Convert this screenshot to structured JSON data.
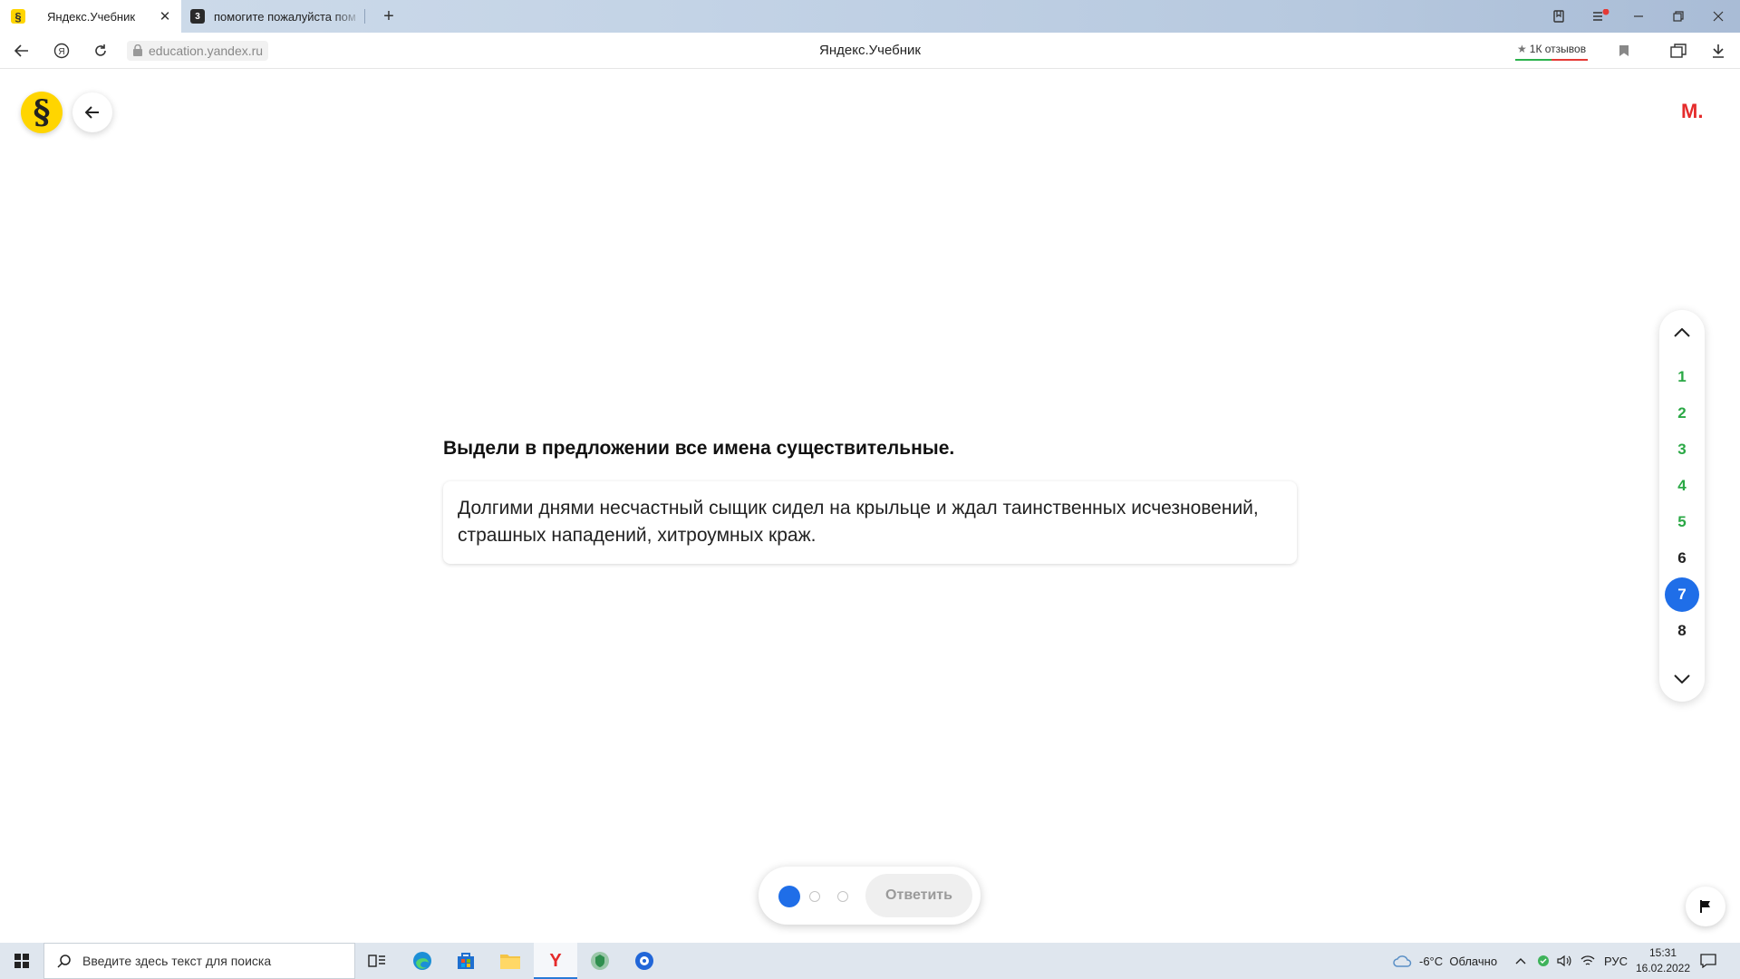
{
  "browser": {
    "tabs": [
      {
        "title": "Яндекс.Учебник",
        "favicon": "§",
        "active": true
      },
      {
        "title": "помогите пожалуйста пом",
        "favicon": "3",
        "active": false
      }
    ],
    "url": "education.yandex.ru",
    "page_title": "Яндекс.Учебник",
    "reviews_label": "1К отзывов"
  },
  "page": {
    "logo_glyph": "§",
    "user_initial": "М.",
    "question": "Выдели в предложении все имена существительные.",
    "sentence": "Долгими днями несчастный сыщик сидел на крыльце и ждал таинственных исчезновений, страшных нападений, хитроумных краж.",
    "navigator": {
      "items": [
        {
          "label": "1",
          "state": "done"
        },
        {
          "label": "2",
          "state": "done"
        },
        {
          "label": "3",
          "state": "done"
        },
        {
          "label": "4",
          "state": "done"
        },
        {
          "label": "5",
          "state": "done"
        },
        {
          "label": "6",
          "state": "todo"
        },
        {
          "label": "7",
          "state": "current"
        },
        {
          "label": "8",
          "state": "todo"
        }
      ]
    },
    "answer_button": "Ответить",
    "attempts": {
      "total": 3,
      "filled": 1
    }
  },
  "taskbar": {
    "search_placeholder": "Введите здесь текст для поиска",
    "weather": "-6°C  Облачно",
    "language": "РУС",
    "time": "15:31",
    "date": "16.02.2022"
  },
  "colors": {
    "accent_blue": "#1f6ee8",
    "done_green": "#2aa845",
    "brand_yellow": "#ffd500",
    "user_red": "#e52b2b"
  }
}
